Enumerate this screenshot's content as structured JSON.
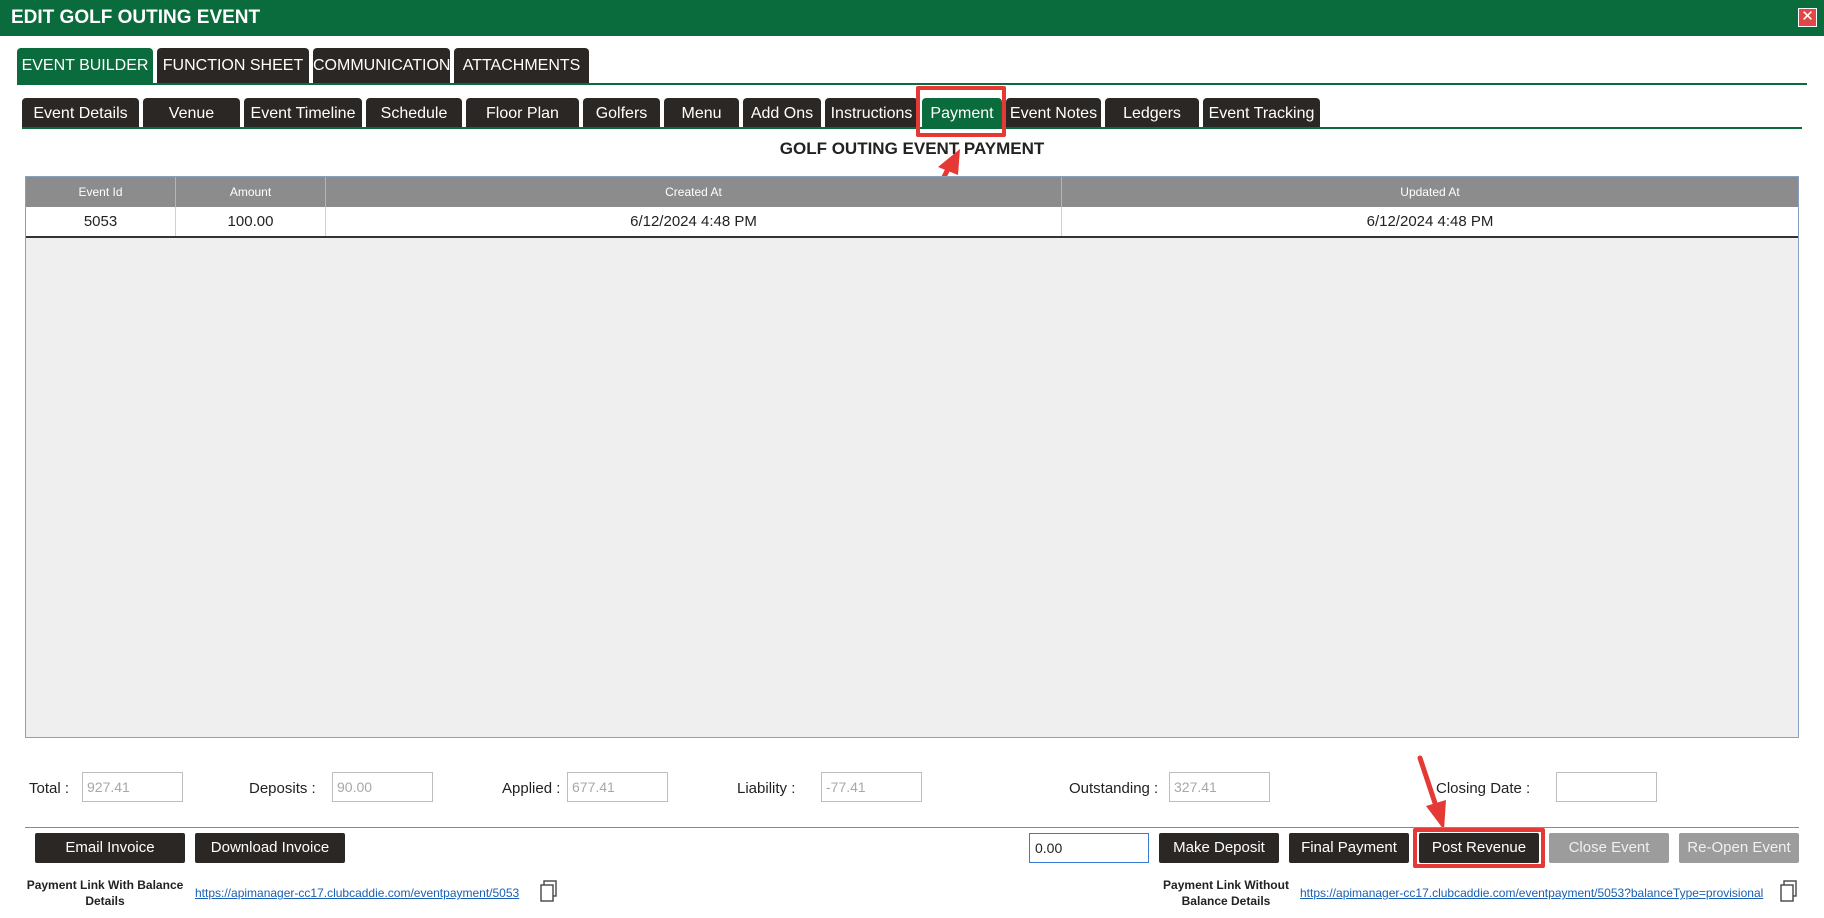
{
  "window": {
    "title": "EDIT GOLF OUTING EVENT",
    "close_glyph": "✕"
  },
  "main_tabs": [
    {
      "label": "EVENT BUILDER",
      "active": true
    },
    {
      "label": "FUNCTION SHEET",
      "active": false
    },
    {
      "label": "COMMUNICATION",
      "active": false
    },
    {
      "label": "ATTACHMENTS",
      "active": false
    }
  ],
  "sub_tabs": [
    {
      "label": "Event Details"
    },
    {
      "label": "Venue"
    },
    {
      "label": "Event Timeline"
    },
    {
      "label": "Schedule"
    },
    {
      "label": "Floor Plan"
    },
    {
      "label": "Golfers"
    },
    {
      "label": "Menu"
    },
    {
      "label": "Add Ons"
    },
    {
      "label": "Instructions"
    },
    {
      "label": "Payment",
      "active": true
    },
    {
      "label": "Event Notes"
    },
    {
      "label": "Ledgers"
    },
    {
      "label": "Event Tracking"
    }
  ],
  "section_title": "GOLF OUTING EVENT PAYMENT",
  "table": {
    "columns": [
      "Event Id",
      "Amount",
      "Created At",
      "Updated At"
    ],
    "rows": [
      [
        "5053",
        "100.00",
        "6/12/2024 4:48 PM",
        "6/12/2024 4:48 PM"
      ]
    ]
  },
  "summary": {
    "total_label": "Total :",
    "total_value": "927.41",
    "deposits_label": "Deposits :",
    "deposits_value": "90.00",
    "applied_label": "Applied :",
    "applied_value": "677.41",
    "liability_label": "Liability :",
    "liability_value": "-77.41",
    "outstanding_label": "Outstanding :",
    "outstanding_value": "327.41",
    "closing_label": "Closing Date :",
    "closing_value": ""
  },
  "actions": {
    "email_invoice": "Email Invoice",
    "download_invoice": "Download Invoice",
    "amount_value": "0.00",
    "make_deposit": "Make Deposit",
    "final_payment": "Final Payment",
    "post_revenue": "Post Revenue",
    "close_event": "Close Event",
    "reopen_event": "Re-Open Event"
  },
  "links": {
    "with_balance_label": "Payment Link With Balance Details",
    "with_balance_url": "https://apimanager-cc17.clubcaddie.com/eventpayment/5053",
    "without_balance_label": "Payment Link Without Balance Details",
    "without_balance_url": "https://apimanager-cc17.clubcaddie.com/eventpayment/5053?balanceType=provisional"
  },
  "colors": {
    "brand_green": "#0a6b3d",
    "tab_dark": "#2b2725",
    "highlight_red": "#e53935"
  }
}
